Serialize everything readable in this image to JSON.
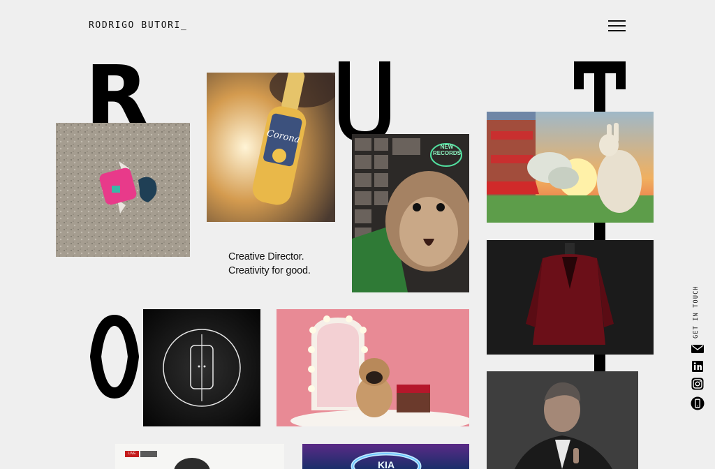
{
  "header": {
    "logo_text": "RODRIGO BUTORI_",
    "menu_icon": "hamburger-menu-icon"
  },
  "hero_letters": {
    "r": "R",
    "u": "U",
    "t": "T",
    "o": "O"
  },
  "tagline": {
    "line1": "Creative Director.",
    "line2": "Creativity for good."
  },
  "tiles": [
    {
      "name": "pink-toy-on-ground"
    },
    {
      "name": "corona-bottle"
    },
    {
      "name": "hamster-new-records"
    },
    {
      "name": "motel-bunny-collage"
    },
    {
      "name": "velvet-jacket"
    },
    {
      "name": "logo-circle-dark"
    },
    {
      "name": "pug-vanity-mirror"
    },
    {
      "name": "man-portrait"
    },
    {
      "name": "live-stream-thumb"
    },
    {
      "name": "kia-neon"
    }
  ],
  "side_contact": {
    "label": "GET IN TOUCH",
    "icons": [
      "mail-icon",
      "linkedin-icon",
      "instagram-icon",
      "phone-icon"
    ]
  },
  "overlay_badges": {
    "hamster_sign_line1": "NEW",
    "hamster_sign_line2": "RECORDS",
    "live_badge": "LIVE",
    "kia_text": "KIA"
  },
  "colors": {
    "background": "#efefef",
    "text": "#111111",
    "pink": "#e83a8a",
    "pug_bg": "#e88a95"
  }
}
